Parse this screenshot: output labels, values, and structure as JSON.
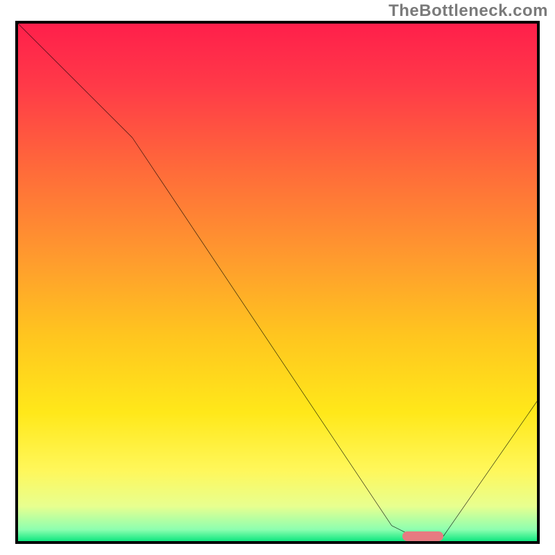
{
  "watermark": "TheBottleneck.com",
  "chart_data": {
    "type": "line",
    "title": "",
    "xlabel": "",
    "ylabel": "",
    "xlim": [
      0,
      100
    ],
    "ylim": [
      0,
      100
    ],
    "grid": false,
    "series": [
      {
        "name": "curve",
        "x": [
          0,
          22,
          72,
          76,
          82,
          100
        ],
        "values": [
          100,
          78,
          3,
          1,
          1,
          27
        ]
      }
    ],
    "annotations": [
      {
        "name": "optimal-marker",
        "x_start": 74,
        "x_end": 82,
        "y": 1
      }
    ],
    "gradient_stops": [
      {
        "offset": 0.0,
        "color": "#ff1f4b"
      },
      {
        "offset": 0.12,
        "color": "#ff3a48"
      },
      {
        "offset": 0.28,
        "color": "#ff6a3a"
      },
      {
        "offset": 0.45,
        "color": "#ff9a2e"
      },
      {
        "offset": 0.6,
        "color": "#ffc51f"
      },
      {
        "offset": 0.75,
        "color": "#ffe81a"
      },
      {
        "offset": 0.86,
        "color": "#fff75a"
      },
      {
        "offset": 0.93,
        "color": "#e8ff8f"
      },
      {
        "offset": 0.975,
        "color": "#8dffb0"
      },
      {
        "offset": 1.0,
        "color": "#00e47a"
      }
    ]
  }
}
